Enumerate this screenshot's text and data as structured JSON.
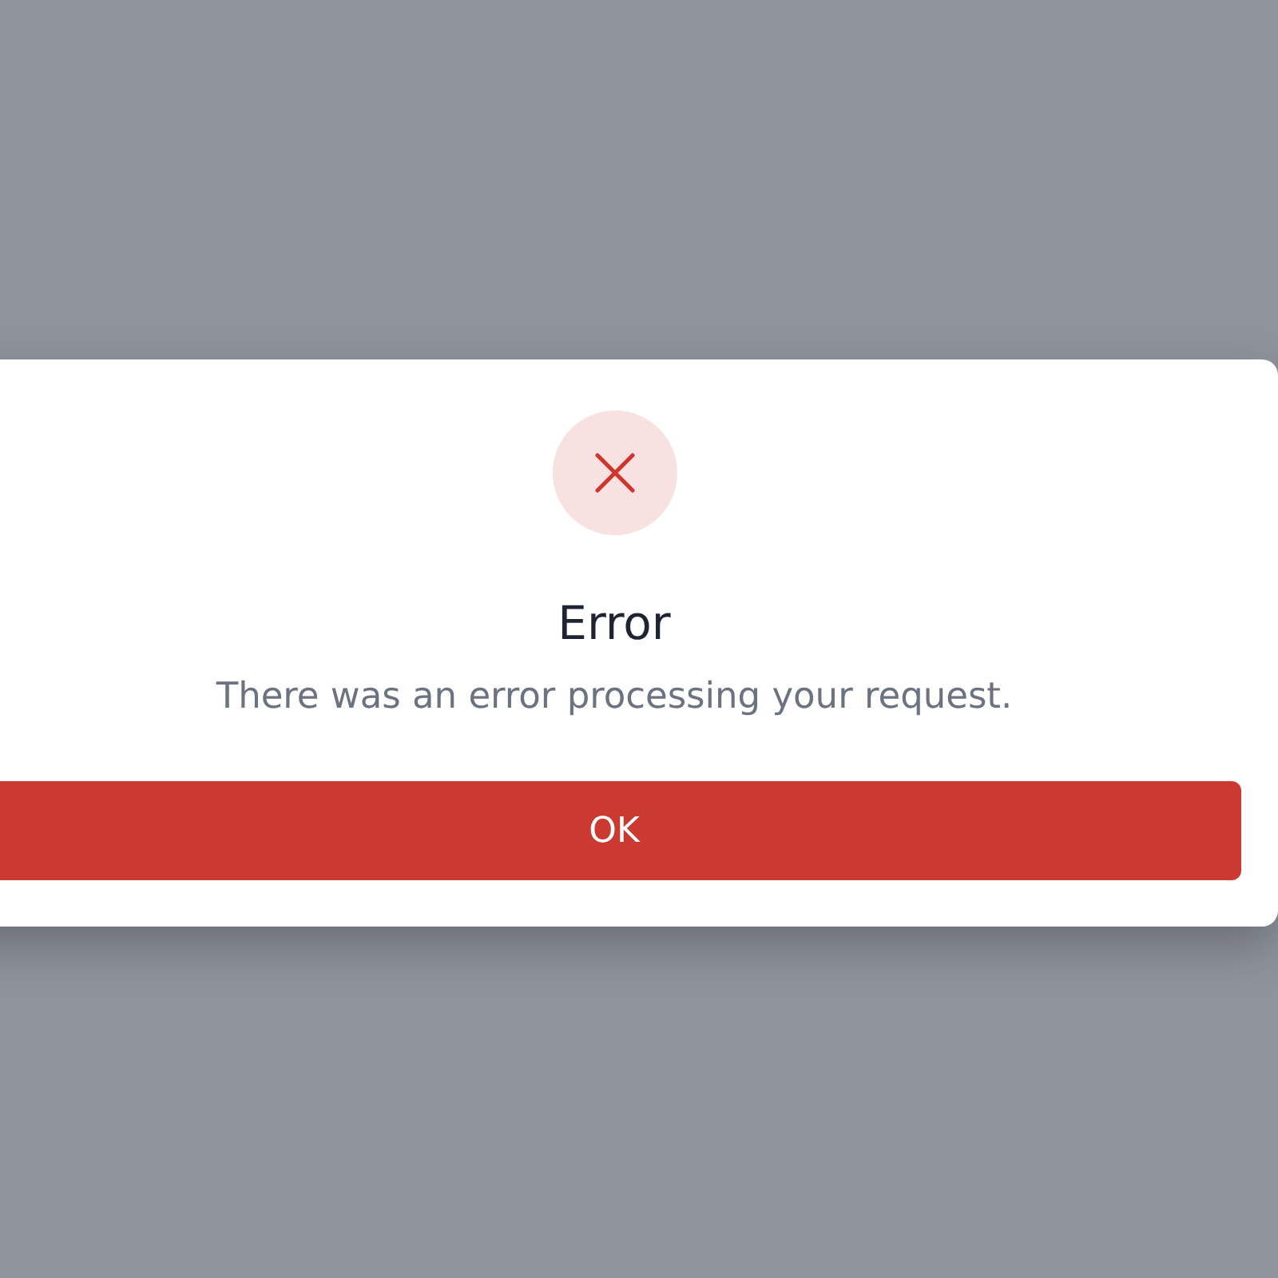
{
  "dialog": {
    "kind": "error",
    "title": "Error",
    "message": "There was an error processing your request.",
    "button": "OK"
  }
}
